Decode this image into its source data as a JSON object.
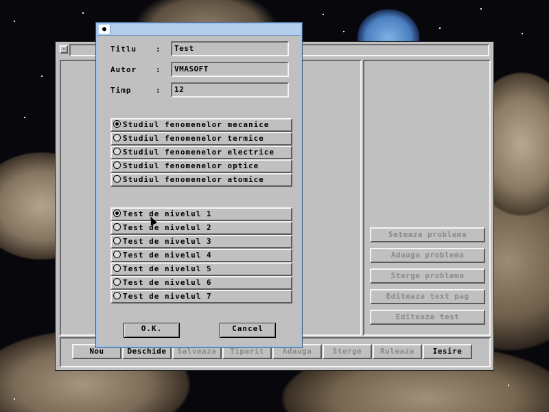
{
  "main_window": {
    "right_buttons": [
      "Seteaza problema",
      "Adauga problema",
      "Sterge problema",
      "Editeaza text pag",
      "Editeaza test"
    ],
    "bottom_buttons": [
      "Nou",
      "Deschide",
      "Salveaza",
      "Tiparit",
      "Adauga",
      "Sterge",
      "Ruleaza",
      "Iesire"
    ]
  },
  "dialog": {
    "sysmenu_glyph": "●",
    "fields": [
      {
        "label": "Titlu",
        "value": "Test"
      },
      {
        "label": "Autor",
        "value": "VMASOFT"
      },
      {
        "label": "Timp",
        "value": "12"
      }
    ],
    "colon": ":",
    "categories": [
      {
        "label": "Studiul fenomenelor mecanice",
        "selected": true
      },
      {
        "label": "Studiul fenomenelor termice",
        "selected": false
      },
      {
        "label": "Studiul fenomenelor electrice",
        "selected": false
      },
      {
        "label": "Studiul fenomenelor optice",
        "selected": false
      },
      {
        "label": "Studiul fenomenelor atomice",
        "selected": false
      }
    ],
    "levels": [
      {
        "label": "Test de nivelul 1",
        "selected": true
      },
      {
        "label": "Test de nivelul 2",
        "selected": false
      },
      {
        "label": "Test de nivelul 3",
        "selected": false
      },
      {
        "label": "Test de nivelul 4",
        "selected": false
      },
      {
        "label": "Test de nivelul 5",
        "selected": false
      },
      {
        "label": "Test de nivelul 6",
        "selected": false
      },
      {
        "label": "Test de nivelul 7",
        "selected": false
      }
    ],
    "ok_label": "O.K.",
    "cancel_label": "Cancel"
  },
  "main_sysmenu_glyph": "-"
}
